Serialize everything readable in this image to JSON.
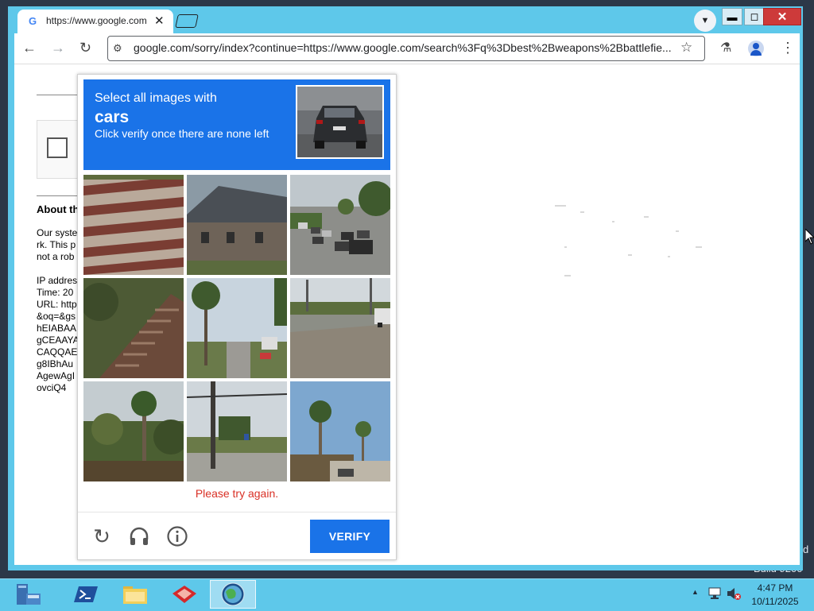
{
  "browser": {
    "tab_title": "https://www.google.com/sorry",
    "tab_close": "✕",
    "url": "google.com/sorry/index?continue=https://www.google.com/search%3Fq%3Dbest%2Bweapons%2Bbattlefie...",
    "google_g": "G"
  },
  "window_controls": {
    "minimize": "▬",
    "maximize": "◻",
    "close": "✕"
  },
  "page": {
    "about_heading": "About th",
    "text_lines": [
      "Our syste",
      "rk. This p",
      "not a rob",
      "",
      "IP addres",
      "Time: 20",
      "URL: http",
      "&oq=&gs",
      "hEIABAA",
      "gCEAAYA",
      "CAQQAE",
      "g8IBhAu",
      "AgewAgI",
      "ovciQ4"
    ]
  },
  "captcha": {
    "instruction_line1": "Select all images with",
    "target": "cars",
    "instruction_line3": "Click verify once there are none left",
    "error_message": "Please try again.",
    "verify_label": "VERIFY"
  },
  "desktop": {
    "build_text": "Build 9200",
    "edge_char": "d"
  },
  "taskbar": {
    "time": "4:47 PM",
    "date": "10/11/2025"
  },
  "colors": {
    "captcha_blue": "#1a73e8",
    "error_red": "#d93025",
    "window_frame": "#5ec8ea"
  },
  "icons": [
    "back-icon",
    "forward-icon",
    "reload-icon",
    "site-info-icon",
    "bookmark-star-icon",
    "labs-icon",
    "menu-icon",
    "refresh-icon",
    "audio-icon",
    "info-icon"
  ]
}
